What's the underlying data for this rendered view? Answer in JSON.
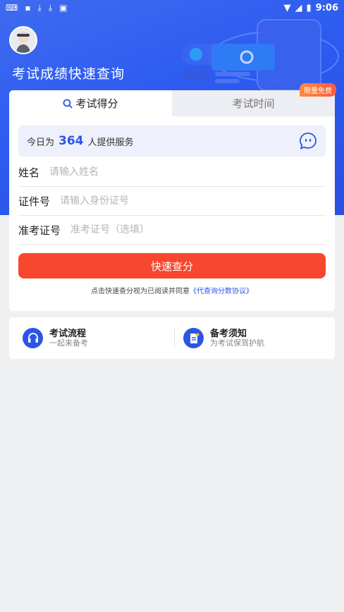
{
  "status_bar": {
    "time": "9:06"
  },
  "header": {
    "title": "考试成绩快速查询"
  },
  "tabs": [
    {
      "label": "考试得分",
      "active": true
    },
    {
      "label": "考试时间",
      "active": false
    }
  ],
  "badge": "限量免费",
  "service": {
    "prefix": "今日为",
    "count": "364",
    "suffix": "人提供服务"
  },
  "form": {
    "name_label": "姓名",
    "name_placeholder": "请输入姓名",
    "id_label": "证件号",
    "id_placeholder": "请输入身份证号",
    "ticket_label": "准考证号",
    "ticket_placeholder": "准考证号（选填）"
  },
  "submit_label": "快速查分",
  "agreement": {
    "text": "点击快速查分视为已阅读并同意",
    "link": "《代查询分数协议》"
  },
  "entries": [
    {
      "title": "考试流程",
      "subtitle": "一起来备考",
      "icon": "headset-icon"
    },
    {
      "title": "备考须知",
      "subtitle": "为考试保驾护航",
      "icon": "document-icon"
    }
  ],
  "colors": {
    "brand": "#2b55e6",
    "submit": "#f7472e",
    "badge": "#ff6a3a"
  }
}
